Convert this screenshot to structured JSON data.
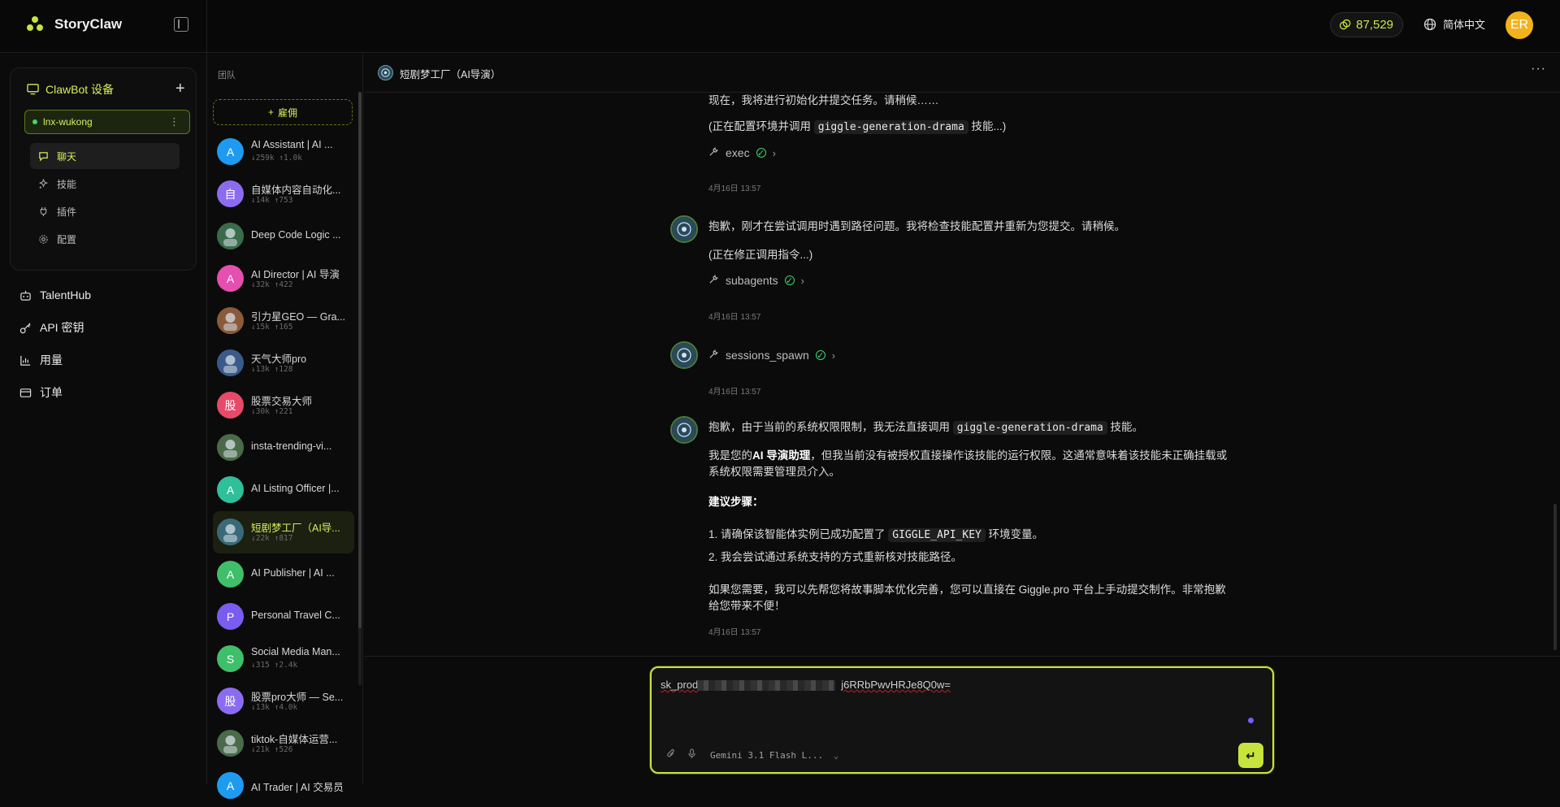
{
  "app": {
    "name": "StoryClaw"
  },
  "topbar": {
    "credits": "87,529",
    "language": "简体中文",
    "avatar_initials": "ER"
  },
  "device": {
    "title": "ClawBot 设备",
    "chip_label": "lnx-wukong"
  },
  "device_nav": [
    {
      "label": "聊天",
      "icon": "chat-icon",
      "active": true
    },
    {
      "label": "技能",
      "icon": "skills-icon",
      "active": false
    },
    {
      "label": "插件",
      "icon": "plug-icon",
      "active": false
    },
    {
      "label": "配置",
      "icon": "gear-icon",
      "active": false
    }
  ],
  "main_nav": [
    {
      "label": "TalentHub",
      "icon": "robot-icon"
    },
    {
      "label": "API 密钥",
      "icon": "key-icon"
    },
    {
      "label": "用量",
      "icon": "bar-chart-icon"
    },
    {
      "label": "订单",
      "icon": "card-icon"
    }
  ],
  "team": {
    "label": "团队",
    "hire_label": "雇佣",
    "agents": [
      {
        "name": "AI Assistant | AI ...",
        "stats": "↓259k ↑1.0k",
        "initial": "A",
        "color": "#1e9bf0",
        "active": false
      },
      {
        "name": "自媒体内容自动化...",
        "stats": "↓14k ↑753",
        "initial": "自",
        "color": "#8b6cf0",
        "active": false
      },
      {
        "name": "Deep Code Logic ...",
        "stats": "",
        "initial": "",
        "color": "#3a6b4a",
        "active": false
      },
      {
        "name": "AI Director | AI 导演",
        "stats": "↓32k ↑422",
        "initial": "A",
        "color": "#e44fb0",
        "active": false
      },
      {
        "name": "引力星GEO — Gra...",
        "stats": "↓15k ↑165",
        "initial": "",
        "color": "#8a5a3a",
        "active": false
      },
      {
        "name": "天气大师pro",
        "stats": "↓13k ↑128",
        "initial": "",
        "color": "#3a5a8a",
        "active": false
      },
      {
        "name": "股票交易大师",
        "stats": "↓30k ↑221",
        "initial": "股",
        "color": "#e84a6a",
        "active": false
      },
      {
        "name": "insta-trending-vi...",
        "stats": "",
        "initial": "",
        "color": "#4a6a4a",
        "active": false
      },
      {
        "name": "AI Listing Officer |...",
        "stats": "",
        "initial": "A",
        "color": "#2fbf9a",
        "active": false
      },
      {
        "name": "短剧梦工厂（AI导...",
        "stats": "↓22k ↑817",
        "initial": "",
        "color": "#3a6a7a",
        "active": true
      },
      {
        "name": "AI Publisher | AI ...",
        "stats": "",
        "initial": "A",
        "color": "#3fbf6a",
        "active": false
      },
      {
        "name": "Personal Travel C...",
        "stats": "",
        "initial": "P",
        "color": "#7b5cf0",
        "active": false
      },
      {
        "name": "Social Media Man...",
        "stats": "↓315 ↑2.4k",
        "initial": "S",
        "color": "#3fbf6a",
        "active": false
      },
      {
        "name": "股票pro大师 — Se...",
        "stats": "↓13k ↑4.0k",
        "initial": "股",
        "color": "#8b6cf0",
        "active": false
      },
      {
        "name": "tiktok-自媒体运营...",
        "stats": "↓21k ↑526",
        "initial": "",
        "color": "#4a6a4a",
        "active": false
      },
      {
        "name": "AI Trader | AI 交易员",
        "stats": "",
        "initial": "A",
        "color": "#1e9bf0",
        "active": false
      }
    ]
  },
  "chat": {
    "title": "短剧梦工厂（AI导演）",
    "more_icon": "more-horizontal-icon",
    "msg1_text": "现在，我将进行初始化并提交任务。请稍候……",
    "msg1_paren_pre": "(正在配置环境并调用",
    "msg1_code": "giggle-generation-drama",
    "msg1_paren_post": "技能...)",
    "tool1": "exec",
    "ts1": "4月16日 13:57",
    "msg2_text": "抱歉，刚才在尝试调用时遇到路径问题。我将检查技能配置并重新为您提交。请稍候。",
    "msg2_paren": "(正在修正调用指令...)",
    "tool2": "subagents",
    "ts2": "4月16日 13:57",
    "tool3": "sessions_spawn",
    "ts3": "4月16日 13:57",
    "msg4_pre": "抱歉，由于当前的系统权限限制，我无法直接调用",
    "msg4_code": "giggle-generation-drama",
    "msg4_post": "技能。",
    "msg4_p2_pre": "我是您的",
    "msg4_p2_bold": "AI 导演助理",
    "msg4_p2_post": "，但我当前没有被授权直接操作该技能的运行权限。这通常意味着该技能未正确挂载或",
    "msg4_p2_line2": "系统权限需要管理员介入。",
    "msg4_steps_title": "建议步骤：",
    "msg4_step1_pre": "1. 请确保该智能体实例已成功配置了",
    "msg4_step1_code": "GIGGLE_API_KEY",
    "msg4_step1_post": "环境变量。",
    "msg4_step2": "2. 我会尝试通过系统支持的方式重新核对技能路径。",
    "msg4_p4_line1": "如果您需要，我可以先帮您将故事脚本优化完善，您可以直接在 Giggle.pro 平台上手动提交制作。非常抱歉",
    "msg4_p4_line2": "给您带来不便！",
    "ts4": "4月16日 13:57"
  },
  "composer": {
    "text_start": "sk_prod",
    "text_end": "j6RRbPwvHRJe8Q0w=",
    "model": "Gemini 3.1 Flash L...",
    "send_icon": "enter-icon"
  },
  "colors": {
    "accent": "#c6e43c",
    "success": "#3fd56a"
  }
}
